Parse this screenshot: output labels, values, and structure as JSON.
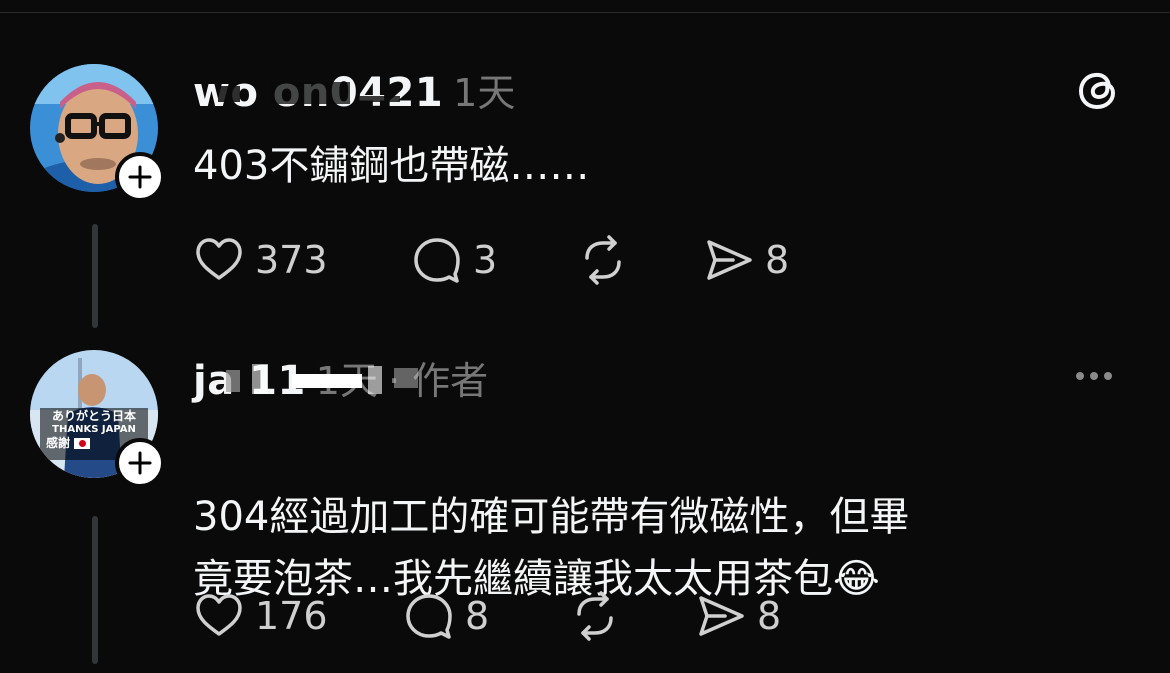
{
  "posts": [
    {
      "username": "wo   on0421",
      "time": "1天",
      "meta_extra": "",
      "body": "403不鏽鋼也帶磁……",
      "counts": {
        "likes": "373",
        "replies": "3",
        "reposts": "",
        "shares": "8"
      }
    },
    {
      "username": "ja       11",
      "time": "1天",
      "meta_extra": "· 作者",
      "body": "304經過加工的確可能帶有微磁性，但畢\n竟要泡茶…我先繼續讓我太太用茶包",
      "body_emoji": "😂",
      "avatar_text": {
        "line1": "ありがとう日本",
        "line2": "THANKS JAPAN",
        "line3": "感謝"
      },
      "counts": {
        "likes": "176",
        "replies": "8",
        "reposts": "",
        "shares": "8"
      }
    }
  ],
  "icons": {
    "app_logo": "threads-logo-icon",
    "more": "more-horizontal-icon",
    "like": "heart-icon",
    "reply": "comment-icon",
    "repost": "repost-icon",
    "share": "share-icon",
    "follow": "plus-icon"
  },
  "colors": {
    "background": "#0a0a0a",
    "text": "#f3f5f7",
    "muted": "#777777",
    "thread_line": "#333638"
  }
}
